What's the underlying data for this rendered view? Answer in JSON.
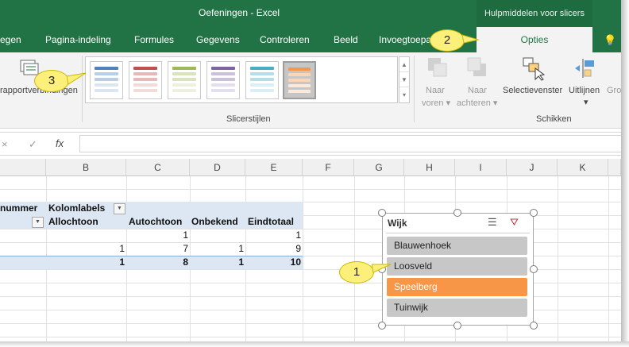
{
  "window": {
    "title": "Oefeningen - Excel",
    "context_group": "Hulpmiddelen voor slicers"
  },
  "tabs": [
    {
      "label": "egen"
    },
    {
      "label": "Pagina-indeling"
    },
    {
      "label": "Formules"
    },
    {
      "label": "Gegevens"
    },
    {
      "label": "Controleren"
    },
    {
      "label": "Beeld"
    },
    {
      "label": "Invoegtoepa"
    }
  ],
  "active_tab": {
    "label": "Opties"
  },
  "ribbon": {
    "report_connections_label": "rapportverbindingen",
    "slicer_styles_group": "Slicerstijlen",
    "arrange_group": "Schikken",
    "bring_forward": {
      "line1": "Naar",
      "line2": "voren"
    },
    "send_backward": {
      "line1": "Naar",
      "line2": "achteren"
    },
    "selection_pane": "Selectievenster",
    "align": "Uitlijnen",
    "group_partial": "Gro",
    "styles": [
      {
        "name": "blue",
        "color": "#4f81bd",
        "light": "#b9cde5"
      },
      {
        "name": "red",
        "color": "#c0504d",
        "light": "#e6b9b8"
      },
      {
        "name": "green",
        "color": "#9bbb59",
        "light": "#d7e4bd"
      },
      {
        "name": "purple",
        "color": "#8064a2",
        "light": "#ccc1da"
      },
      {
        "name": "aqua",
        "color": "#4bacc6",
        "light": "#b7dee8"
      },
      {
        "name": "orange",
        "color": "#f79646",
        "light": "#fcd5b5",
        "selected": true
      }
    ]
  },
  "formula_bar": {
    "cancel": "×",
    "enter": "✓",
    "fx": "fx"
  },
  "columns": [
    "B",
    "C",
    "D",
    "E",
    "F",
    "G",
    "H",
    "I",
    "J",
    "K"
  ],
  "pivot": {
    "row_label_partial": "nummer",
    "col_labels": "Kolomlabels",
    "headers": [
      "Allochtoon",
      "Autochtoon",
      "Onbekend",
      "Eindtotaal"
    ],
    "rows": [
      [
        "",
        "1",
        "",
        "1"
      ],
      [
        "1",
        "7",
        "1",
        "9"
      ]
    ],
    "totals": [
      "1",
      "8",
      "1",
      "10"
    ]
  },
  "slicer": {
    "title": "Wijk",
    "items": [
      {
        "label": "Blauwenhoek",
        "selected": false
      },
      {
        "label": "Loosveld",
        "selected": false
      },
      {
        "label": "Speelberg",
        "selected": true
      },
      {
        "label": "Tuinwijk",
        "selected": false
      }
    ]
  },
  "callouts": {
    "one": "1",
    "two": "2",
    "three": "3"
  },
  "colors": {
    "excel_green": "#217346",
    "slicer_selected": "#f79646",
    "slicer_item": "#c7c7c7",
    "callout": "#fdf07a"
  }
}
